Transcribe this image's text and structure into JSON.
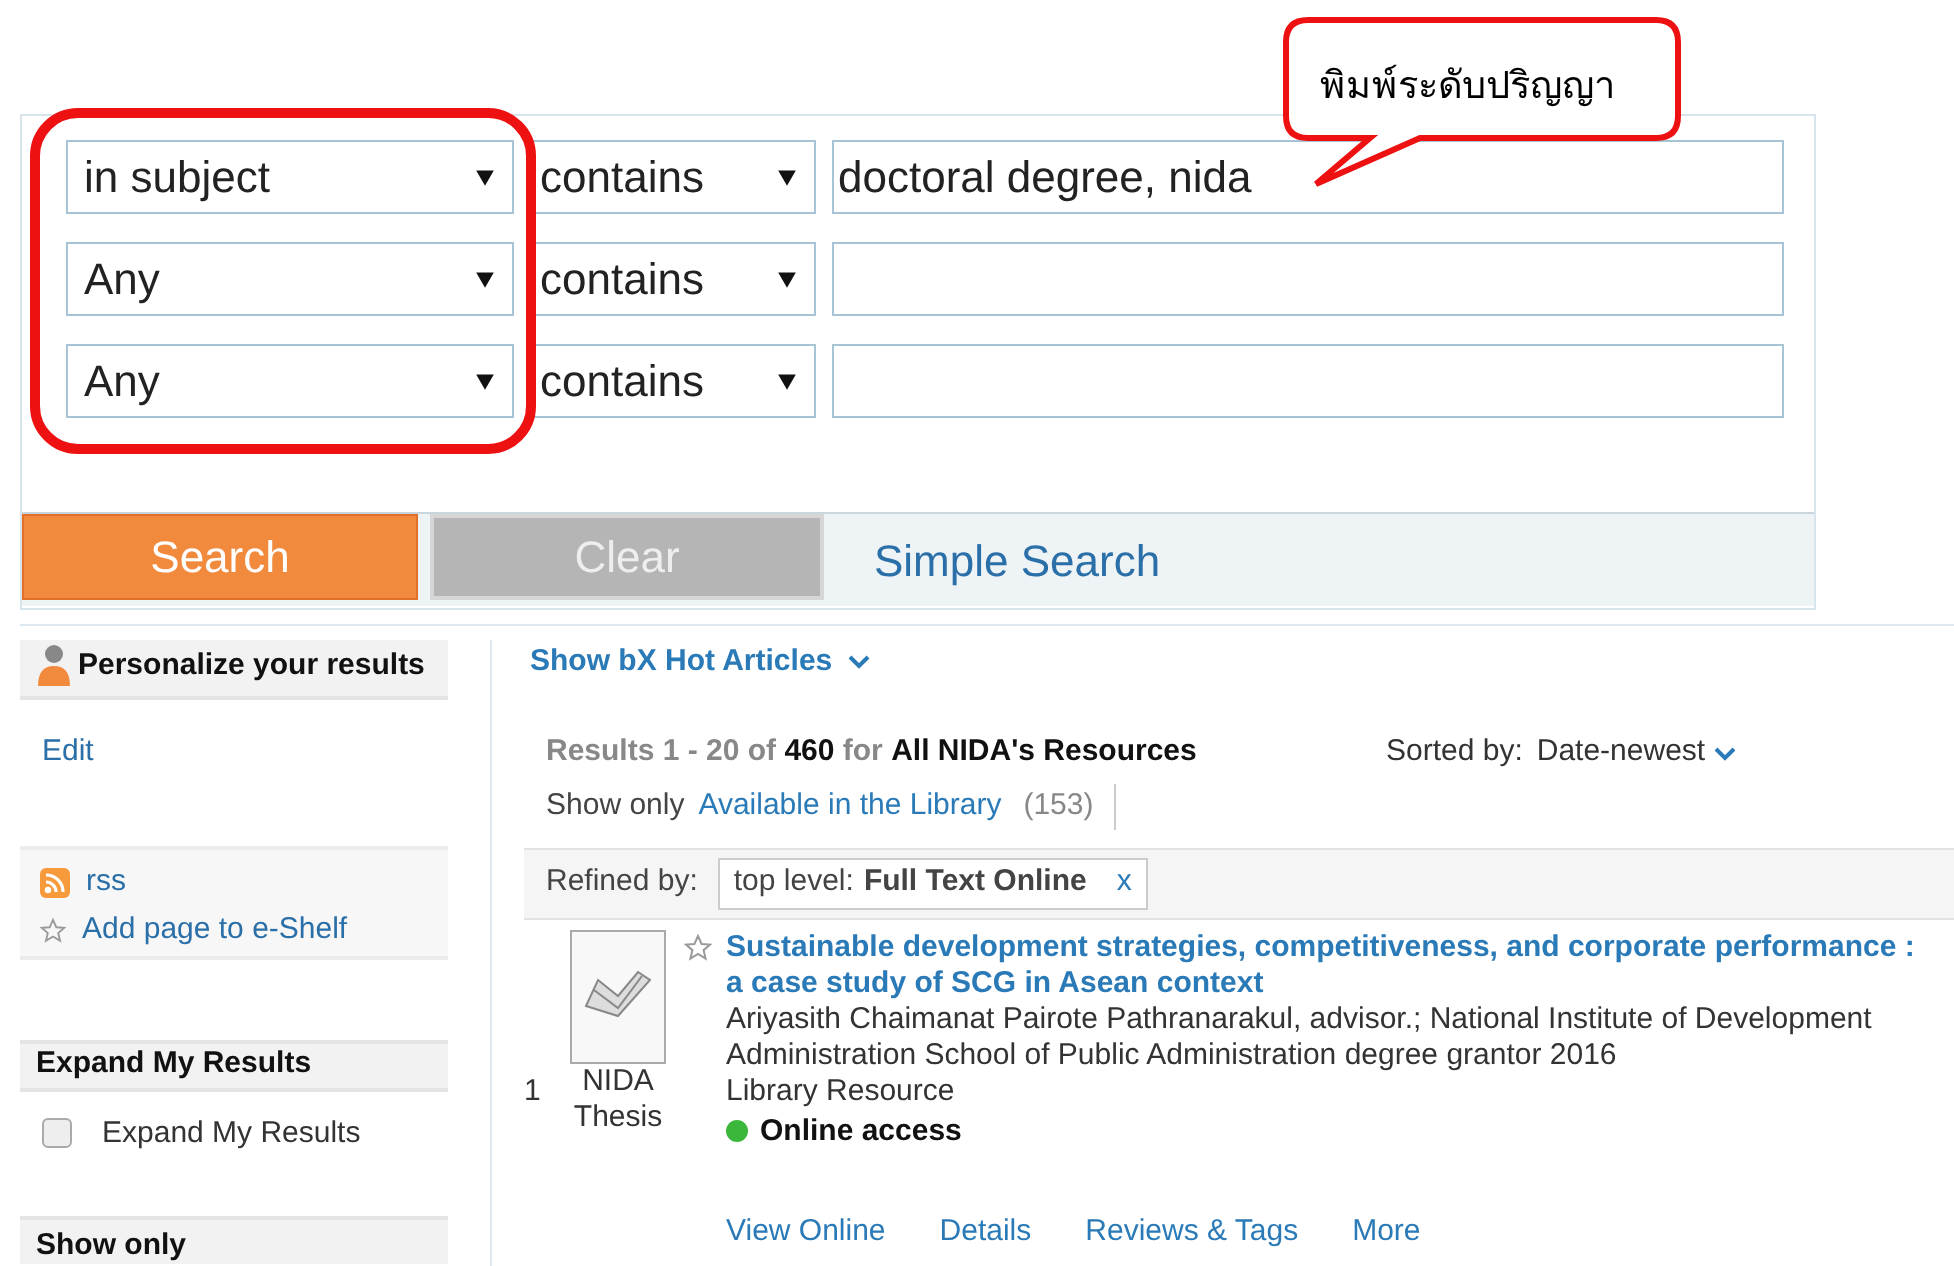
{
  "search_form": {
    "rows": [
      {
        "field": "in subject",
        "operator": "contains",
        "value": "doctoral degree, nida"
      },
      {
        "field": "Any",
        "operator": "contains",
        "value": ""
      },
      {
        "field": "Any",
        "operator": "contains",
        "value": ""
      }
    ],
    "buttons": [
      "Search",
      "Clear"
    ],
    "simple_search_link": "Simple Search"
  },
  "callout": {
    "text": "พิมพ์ระดับปริญญา"
  },
  "sidebar": {
    "personalize": {
      "title": "Personalize your results",
      "edit_link": "Edit"
    },
    "links": [
      {
        "kind": "rss",
        "label": "rss"
      },
      {
        "kind": "star",
        "label": "Add page to e-Shelf"
      }
    ],
    "expand": {
      "title": "Expand My Results",
      "checkbox": {
        "label": "Expand My Results",
        "checked": false
      }
    },
    "show_only_title": "Show only"
  },
  "results": {
    "hot_articles_link": "Show bX Hot Articles",
    "summary": "Results 1 - 20 of **460**  for **All NIDA's Resources**",
    "sorted_label": "Sorted by:",
    "sorted_value": "Date-newest",
    "show_only_label": "Show only",
    "show_only_link": "Available in the Library",
    "show_only_count": "(153)",
    "refined_label": "Refined by:",
    "refinement": {
      "facet": "top level:",
      "value": "Full Text Online",
      "remove": "x"
    },
    "items": [
      {
        "number": "1",
        "type_label": "NIDA Thesis",
        "title": "Sustainable development strategies, competitiveness, and corporate performance : a case study of SCG in Asean context",
        "authors": "Ariyasith Chaimanat Pairote Pathranarakul, advisor.; National Institute of Development Administration School of Public Administration degree grantor 2016",
        "resource": "Library Resource",
        "availability": "Online access",
        "online": true,
        "actions": [
          "View Online",
          "Details",
          "Reviews & Tags",
          "More"
        ]
      }
    ]
  }
}
